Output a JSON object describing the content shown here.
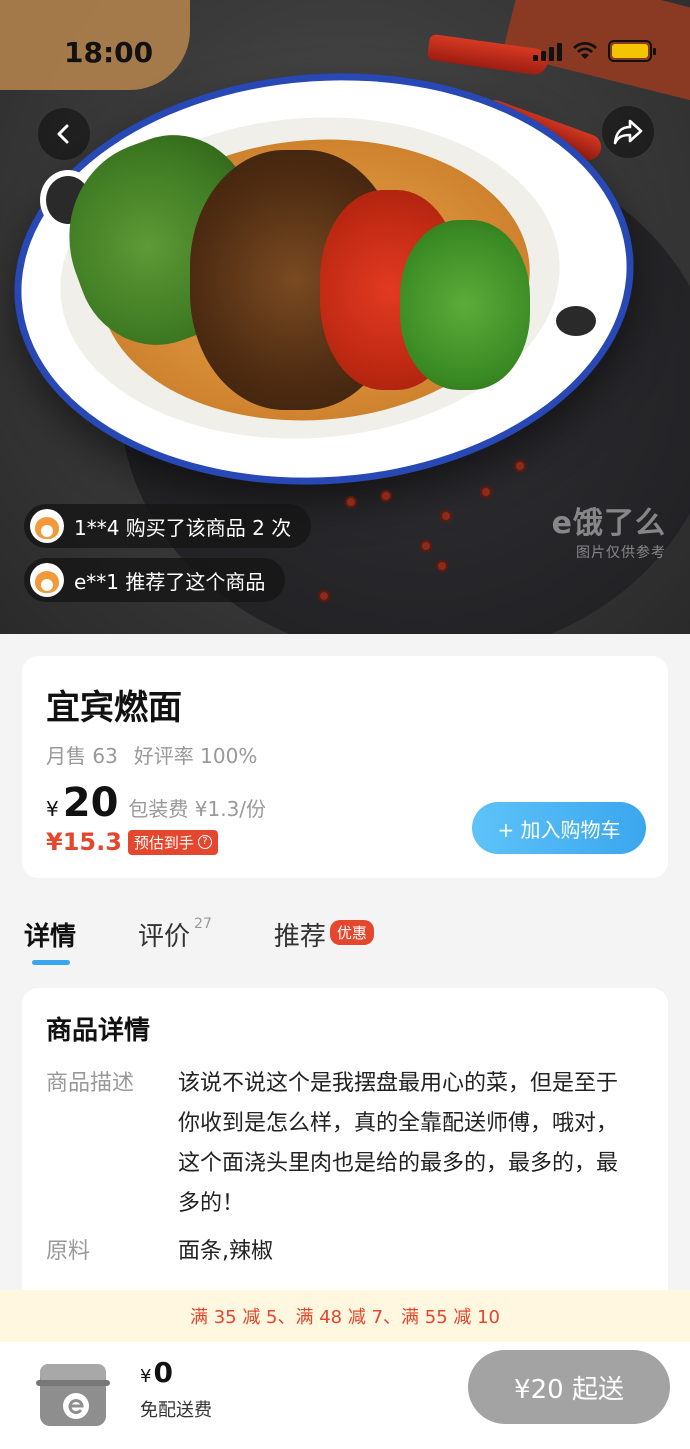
{
  "status_bar": {
    "time": "18:00"
  },
  "hero": {
    "watermark": "e饿了么",
    "watermark_sub": "图片仅供参考",
    "toasts": [
      {
        "text": "1**4 购买了该商品 2 次"
      },
      {
        "text": "e**1 推荐了这个商品"
      }
    ]
  },
  "product": {
    "name": "宜宾燃面",
    "monthly_sales": "月售 63",
    "rating": "好评率 100%",
    "currency": "¥",
    "price": "20",
    "packing_fee": "包装费 ¥1.3/份",
    "estimated_price": "¥15.3",
    "estimated_tag": "预估到手",
    "add_to_cart": "+ 加入购物车"
  },
  "tabs": [
    {
      "label": "详情",
      "count": "",
      "badge": ""
    },
    {
      "label": "评价",
      "count": "27",
      "badge": ""
    },
    {
      "label": "推荐",
      "count": "",
      "badge": "优惠"
    }
  ],
  "details": {
    "title": "商品详情",
    "description_label": "商品描述",
    "description": "该说不说这个是我摆盘最用心的菜，但是至于你收到是怎么样，真的全靠配送师傅，哦对，这个面浇头里肉也是给的最多的，最多的，最多的！",
    "ingredients_label": "原料",
    "ingredients": "面条,辣椒"
  },
  "promo": "满 35 减 5、满 48 减 7、满 55 减 10",
  "cart": {
    "currency": "¥",
    "total": "0",
    "delivery": "免配送费",
    "start_button": "¥20 起送"
  },
  "colors": {
    "accent": "#3aa6ee",
    "price_red": "#e4472e",
    "promo_bg": "#fff7df",
    "disabled": "#a3a3a3"
  }
}
